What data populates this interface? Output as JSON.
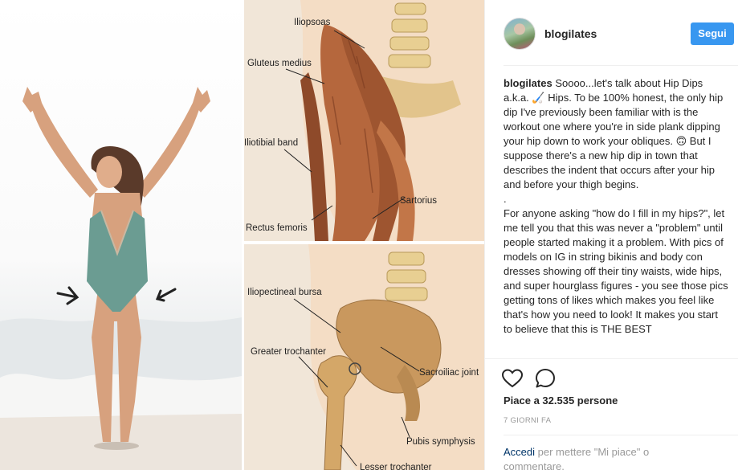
{
  "post": {
    "username": "blogilates",
    "follow_label": "Segui"
  },
  "caption": {
    "username": "blogilates",
    "paragraph1": "Soooo...let's talk about Hip Dips a.k.a. 🏑 Hips. To be 100% honest, the only hip dip I've previously been familiar with is the workout one where you're in side plank dipping your hip down to work your obliques. 🙃 But I suppose there's a new hip dip in town that describes the indent that occurs after your hip and before your thigh begins.",
    "separator": ".",
    "paragraph2": "For anyone asking \"how do I fill in my hips?\", let me tell you that this was never a \"problem\" until people started making it a problem. With pics of models on IG in string bikinis and body con dresses showing off their tiny waists, wide hips, and super hourglass figures - you see those pics getting tons of likes which makes you feel like that's how you need to look! It makes you start to believe that this is THE BEST"
  },
  "actions": {
    "like_icon": "heart-icon",
    "comment_icon": "comment-icon",
    "likes_text": "Piace a 32.535 persone",
    "time_text": "7 GIORNI FA"
  },
  "login_prompt": {
    "link_text": "Accedi",
    "rest_text": " per mettere \"Mi piace\" o commentare."
  },
  "anatomy": {
    "top_labels": [
      "Iliopsoas",
      "Gluteus medius",
      "Iliotibial band",
      "Sartorius",
      "Rectus femoris"
    ],
    "bottom_labels": [
      "Iliopectineal bursa",
      "Greater trochanter",
      "Sacroiliac joint",
      "Pubis symphysis",
      "Lesser trochanter"
    ]
  },
  "colors": {
    "follow_button": "#3897f0",
    "swimsuit": "#6b9c92",
    "muscle": "#b5673d",
    "bone": "#c9985e"
  }
}
